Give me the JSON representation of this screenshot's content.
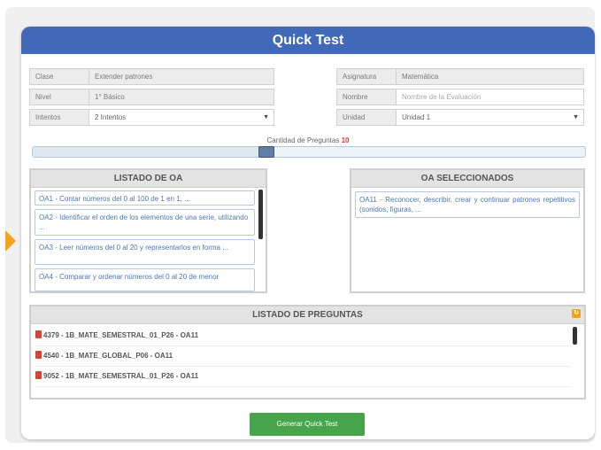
{
  "header": {
    "title": "Quick Test"
  },
  "form": {
    "clase": {
      "label": "Clase",
      "value": "Extender patrones"
    },
    "nivel": {
      "label": "Nivel",
      "value": "1° Básico"
    },
    "intentos": {
      "label": "Intentos",
      "value": "2 Intentos"
    },
    "asignatura": {
      "label": "Asignatura",
      "value": "Matemática"
    },
    "nombre": {
      "label": "Nombre",
      "placeholder": "Nombre de la Evaluación"
    },
    "unidad": {
      "label": "Unidad",
      "value": "Unidad 1"
    }
  },
  "questions_count": {
    "label": "Cantidad de Preguntas",
    "value": "10",
    "fraction": 0.42
  },
  "listado_oa": {
    "title": "LISTADO DE OA",
    "items": [
      "OA1 - Contar números del 0 al 100 de 1 en 1, ...",
      "OA2 - Identificar el orden de los elementos de una serie, utilizando ...",
      "OA3 - Leer números del 0 al 20 y representarlos en forma ...",
      "OA4 - Comparar y ordenar números del 0 al 20 de menor"
    ]
  },
  "oa_seleccionados": {
    "title": "OA SELECCIONADOS",
    "items": [
      "OA11 - Reconocer, describir, crear y continuar patrones repetitivos (sonidos, figuras, ..."
    ]
  },
  "listado_preguntas": {
    "title": "LISTADO DE PREGUNTAS",
    "items": [
      "4379 - 1B_MATE_SEMESTRAL_01_P26 - OA11",
      "4540 - 1B_MATE_GLOBAL_P06 - OA11",
      "9052 - 1B_MATE_SEMESTRAL_01_P26 - OA11"
    ]
  },
  "generate_button": {
    "label": "Generar Quick Test"
  },
  "colors": {
    "header": "#4169b7",
    "accent_red": "#e53935",
    "button_green": "#46a44b",
    "arrow": "#f6a21b"
  }
}
